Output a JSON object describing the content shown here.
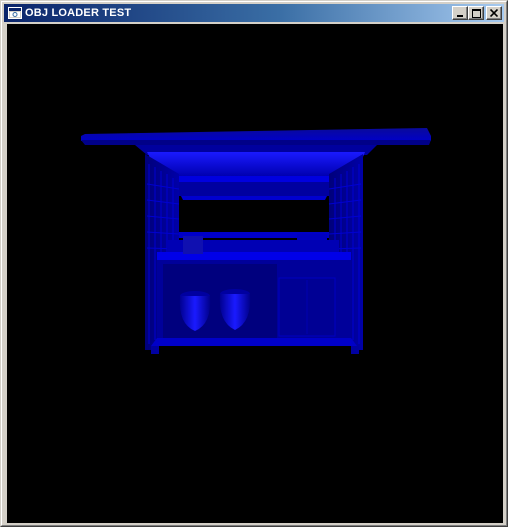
{
  "window": {
    "title": "OBJ LOADER TEST",
    "icon": "app-window-icon",
    "controls": {
      "minimize": "minimize-icon",
      "maximize": "maximize-icon",
      "close": "close-icon"
    }
  },
  "viewport": {
    "background": "#000000",
    "model_color": "#0000ff",
    "model": "market-stall-3d-model"
  }
}
